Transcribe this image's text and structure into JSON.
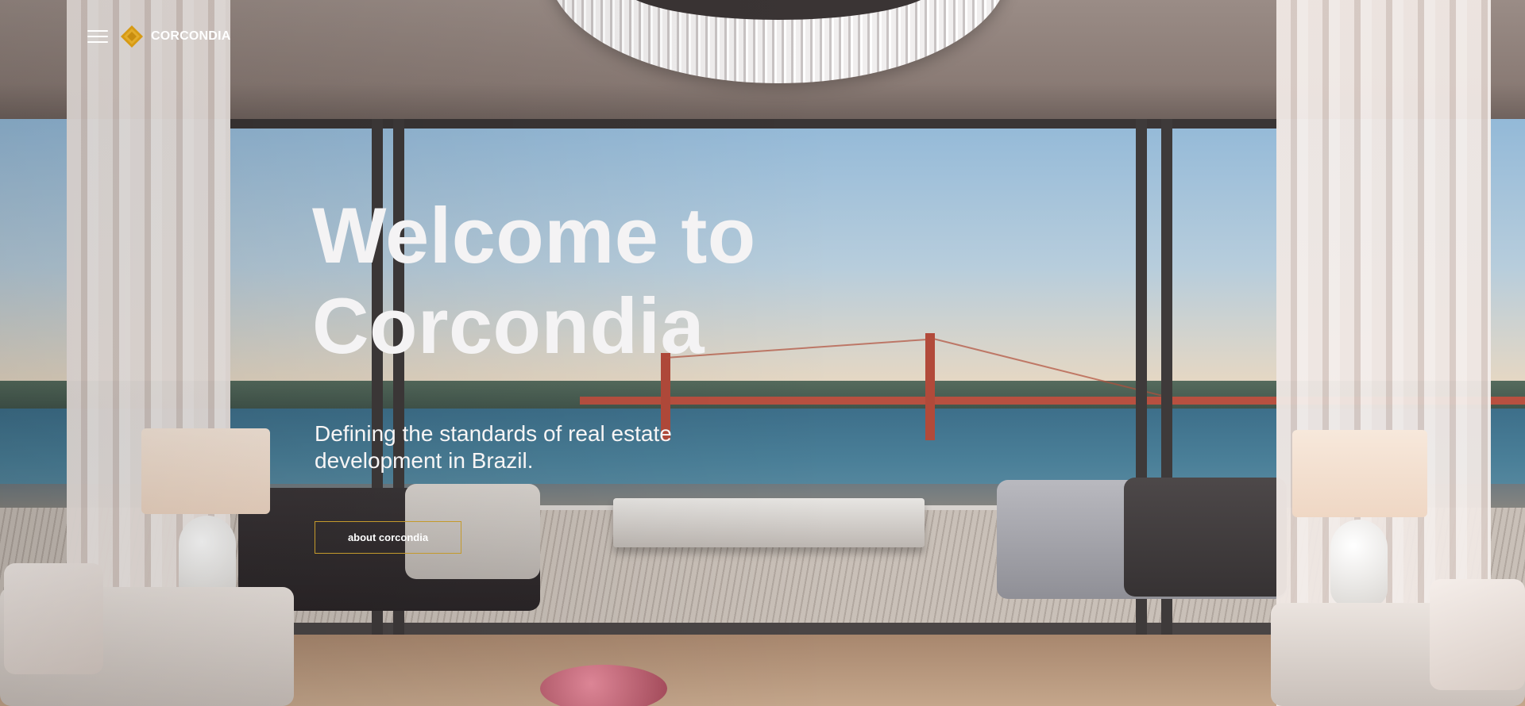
{
  "header": {
    "menu_icon": "hamburger-icon",
    "logo_icon": "diamond-logo-icon",
    "brand_name": "CORCONDIA"
  },
  "hero": {
    "title": "Welcome to Corcondia",
    "subtitle": "Defining the standards of real estate development in Brazil.",
    "cta_label": "about corcondia"
  },
  "colors": {
    "accent_gold": "#c49a2c",
    "text_white": "#f4f3f4"
  }
}
